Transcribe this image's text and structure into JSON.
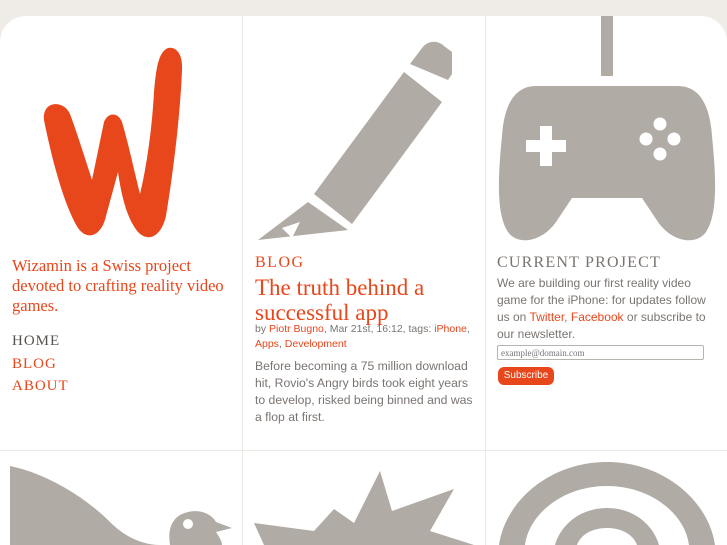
{
  "colors": {
    "accent": "#e8461b",
    "gray": "#b1aba6",
    "text": "#7a7470"
  },
  "intro": {
    "tagline": "Wizamin is a Swiss project devoted to crafting reality video games.",
    "nav": [
      {
        "label": "HOME"
      },
      {
        "label": "BLOG"
      },
      {
        "label": "ABOUT"
      }
    ]
  },
  "blog": {
    "section_label": "BLOG",
    "post_title": "The truth behind a successful app",
    "meta_prefix": "by",
    "author": "Piotr Bugno",
    "date": ", Mar 21st, 16:12, tags:",
    "tags": [
      "iPhone",
      "Apps",
      "Development"
    ],
    "excerpt": "Before becoming a 75 million download hit, Rovio's Angry birds took eight years to develop, risked being binned and was a flop at first."
  },
  "current_project": {
    "title": "CURRENT PROJECT",
    "text_1": "We are building our first reality video game for the iPhone: for updates follow us on",
    "twitter": "Twitter",
    "sep": ",",
    "facebook": "Facebook",
    "text_2": "or subscribe to our newsletter.",
    "email_placeholder": "example@domain.com",
    "subscribe_label": "Subscribe"
  },
  "icons": [
    "wizamin-logo-icon",
    "pencil-icon",
    "gamepad-icon",
    "bird-icon",
    "explosion-icon",
    "at-sign-icon"
  ]
}
